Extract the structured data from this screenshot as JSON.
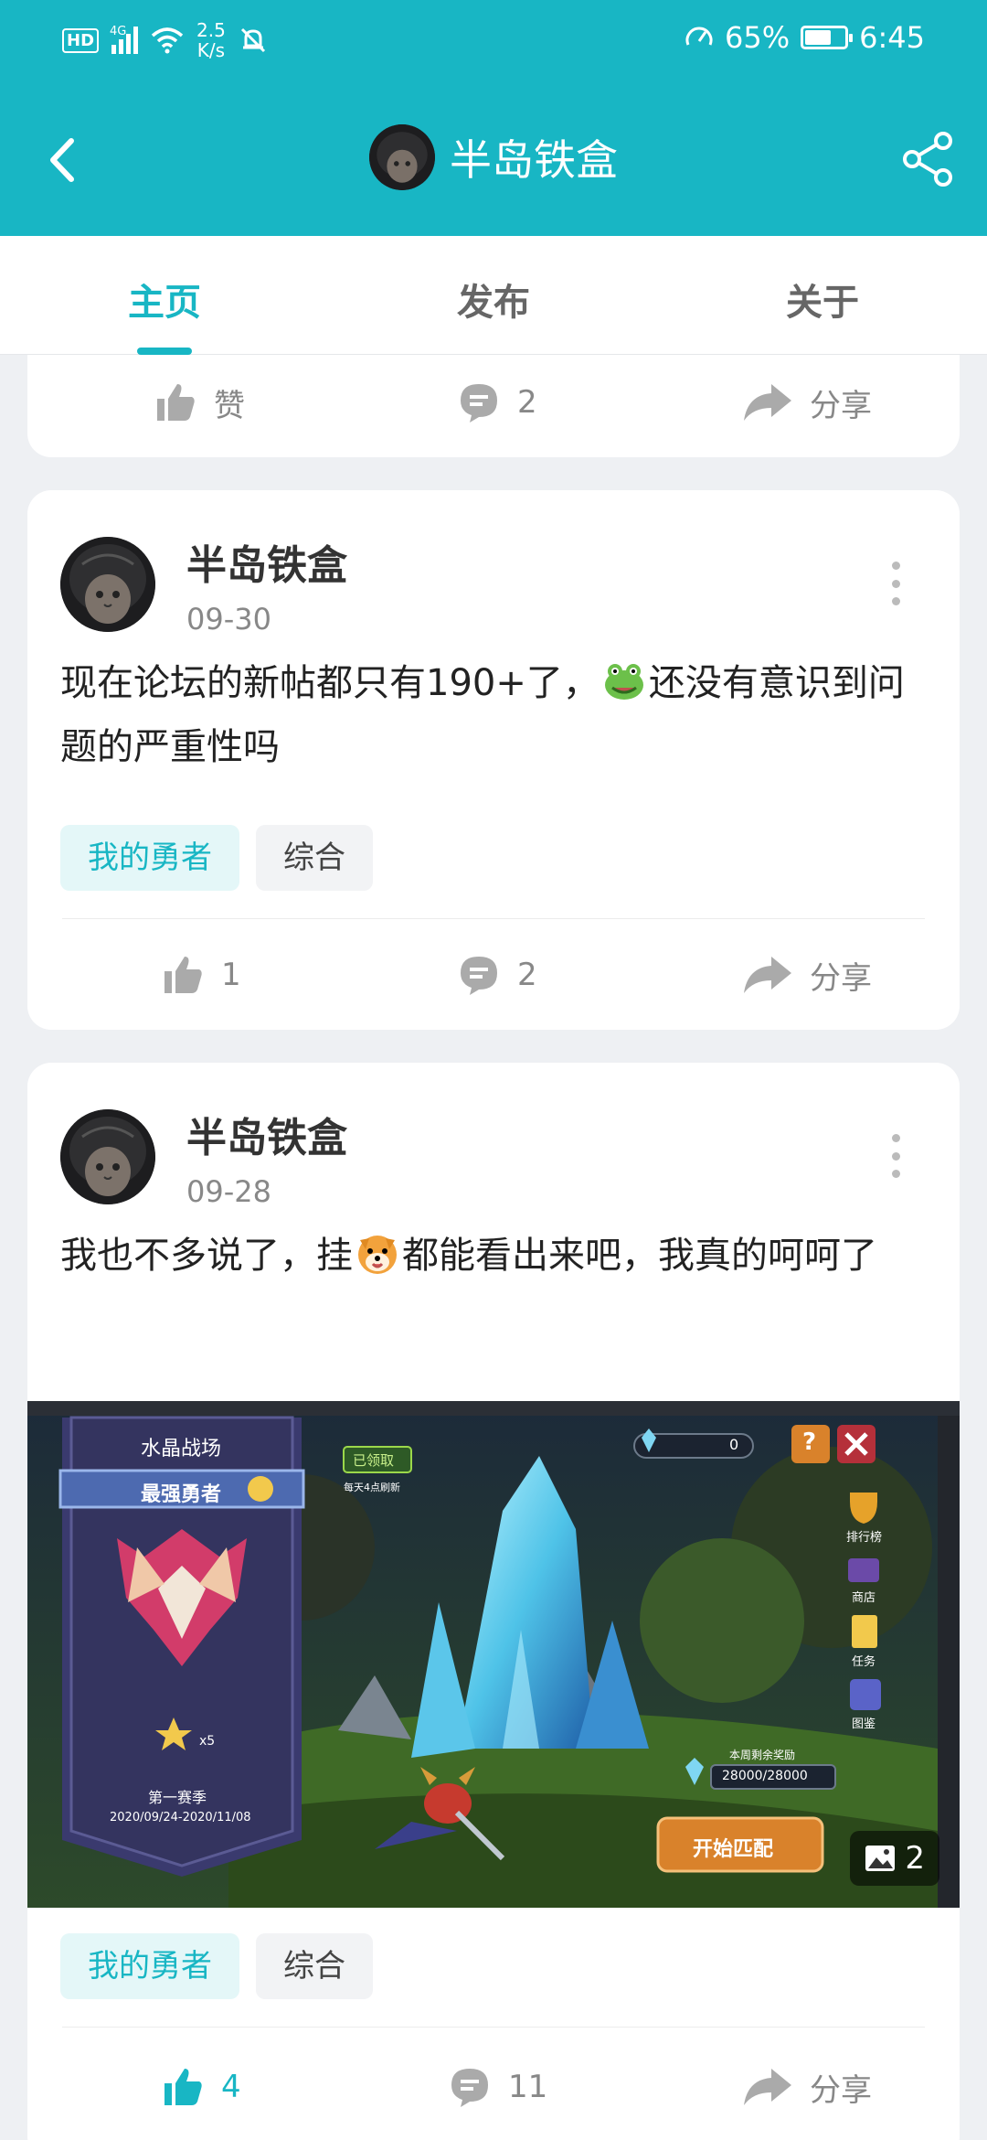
{
  "status_bar": {
    "hd": "HD",
    "net": "4G",
    "speed_top": "2.5",
    "speed_bottom": "K/s",
    "battery": "65%",
    "time": "6:45"
  },
  "header": {
    "title": "半岛铁盒"
  },
  "tabs": [
    {
      "label": "主页",
      "active": true
    },
    {
      "label": "发布"
    },
    {
      "label": "关于"
    }
  ],
  "partial_post": {
    "actions": {
      "like_label": "赞",
      "comments": "2",
      "share_label": "分享"
    }
  },
  "posts": [
    {
      "author": "半岛铁盒",
      "date": "09-30",
      "text_before": "现在论坛的新帖都只有190+了，",
      "emoji": "frog-emoji",
      "text_after": "还没有意识到问题的严重性吗",
      "tags": [
        "我的勇者",
        "综合"
      ],
      "likes": "1",
      "comments": "2",
      "share_label": "分享"
    },
    {
      "author": "半岛铁盒",
      "date": "09-28",
      "text_before": "我也不多说了，挂",
      "emoji": "dog-emoji",
      "text_after": "都能看出来吧，我真的呵呵了",
      "image": {
        "count": "2",
        "panel_title": "水晶战场",
        "rank_label": "最强勇者",
        "stars": "x5",
        "season": "第一赛季",
        "season_dates": "2020/09/24-2020/11/08",
        "claimed": "已领取",
        "refresh": "每天4点刷新",
        "crystal_count": "0",
        "menu": [
          "排行榜",
          "商店",
          "任务",
          "图鉴"
        ],
        "reward_label": "本周剩余奖励",
        "reward_value": "28000/28000",
        "start_button": "开始匹配"
      },
      "tags": [
        "我的勇者",
        "综合"
      ],
      "likes": "4",
      "comments": "11",
      "share_label": "分享"
    }
  ],
  "colors": {
    "accent": "#18b6c4"
  }
}
